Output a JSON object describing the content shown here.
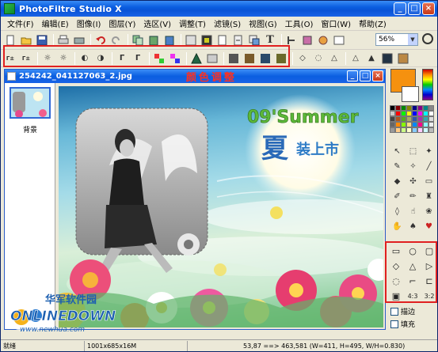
{
  "window": {
    "title": "PhotoFiltre Studio X"
  },
  "menu": [
    "文件(F)",
    "编辑(E)",
    "图像(I)",
    "图层(Y)",
    "选区(V)",
    "调整(T)",
    "滤镜(S)",
    "视图(G)",
    "工具(O)",
    "窗口(W)",
    "帮助(Z)"
  ],
  "toolbar": {
    "zoom_value": "56%"
  },
  "document": {
    "filename": "254242_041127063_2.jpg",
    "annotation_label": "颜色调整",
    "thumbnail_label": "背景",
    "poster_year": "09'Summer",
    "poster_headline": "夏",
    "poster_subline": "装上市"
  },
  "right_panel": {
    "fill_colors": {
      "foreground": "#f5910f",
      "background": "#ffffff"
    },
    "checkboxes": [
      {
        "label": "描边",
        "checked": false
      },
      {
        "label": "填充",
        "checked": false
      }
    ]
  },
  "status": {
    "state": "就绪",
    "dimensions": "1001x685x16M",
    "coords": "53,87 ==> 463,581 (W=411, H=495, W/H=0.830)"
  },
  "watermark": {
    "chinese": "华军软件园",
    "brand": "ONLINEDOWN",
    "url": "www.newhua.com"
  },
  "highlight_color": "#e02020"
}
